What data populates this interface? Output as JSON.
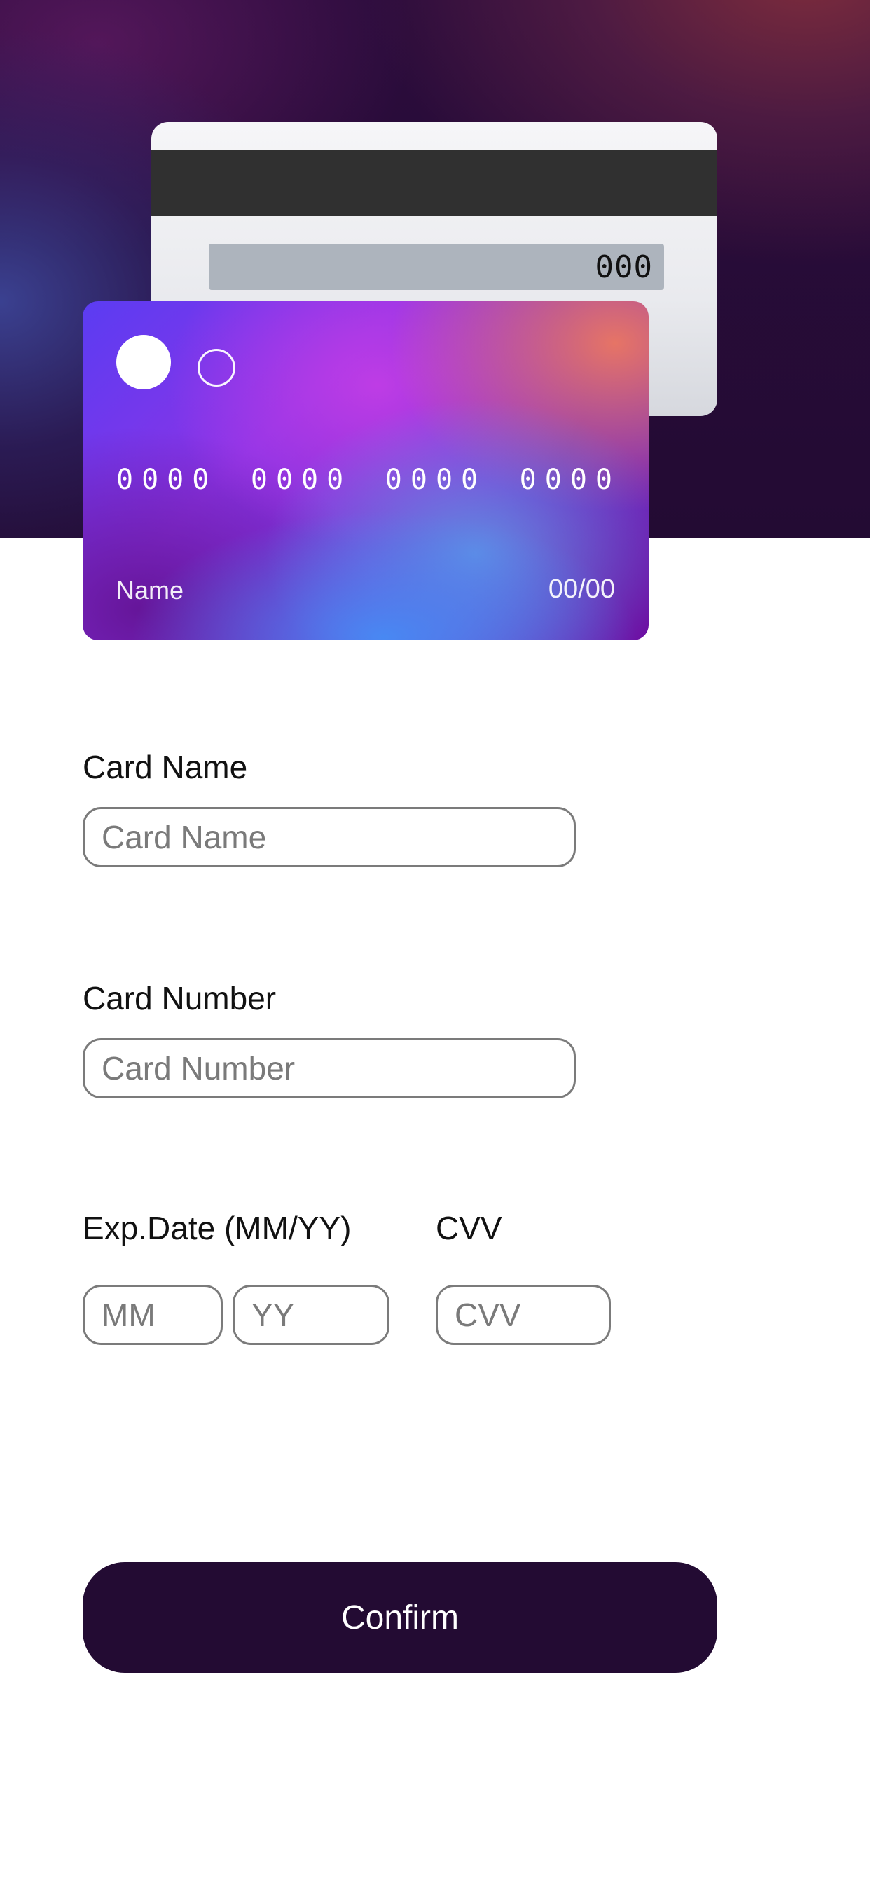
{
  "colors": {
    "hero_bg": "#230b33",
    "button_bg": "#230b33",
    "input_border": "#7b7b7b",
    "placeholder": "#7a7a7a"
  },
  "card_back": {
    "cvv": "000"
  },
  "card_front": {
    "number_groups": [
      "0000",
      "0000",
      "0000",
      "0000"
    ],
    "name": "Name",
    "expiry": "00/00"
  },
  "form": {
    "card_name": {
      "label": "Card Name",
      "placeholder": "Card Name",
      "value": ""
    },
    "card_number": {
      "label": "Card Number",
      "placeholder": "Card Number",
      "value": ""
    },
    "exp_date": {
      "label": "Exp.Date (MM/YY)",
      "month_placeholder": "MM",
      "year_placeholder": "YY"
    },
    "cvv": {
      "label": "CVV",
      "placeholder": "CVV"
    }
  },
  "confirm_button": {
    "label": "Confirm"
  }
}
